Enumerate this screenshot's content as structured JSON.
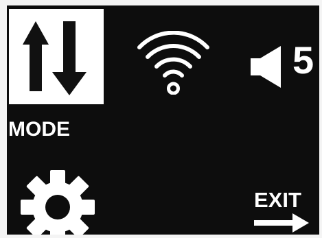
{
  "menu": {
    "mode": {
      "label": "MODE",
      "icon": "up-down-arrows-icon"
    },
    "wifi": {
      "icon": "wifi-icon"
    },
    "volume": {
      "icon": "speaker-icon",
      "value": "5"
    },
    "settings": {
      "icon": "gear-icon"
    },
    "exit": {
      "label": "EXIT",
      "icon": "right-arrow-icon"
    }
  },
  "colors": {
    "screen_background": "#0d0d0d",
    "foreground": "#ffffff",
    "selected_tile": "#ffffff",
    "selected_icon": "#111111"
  }
}
